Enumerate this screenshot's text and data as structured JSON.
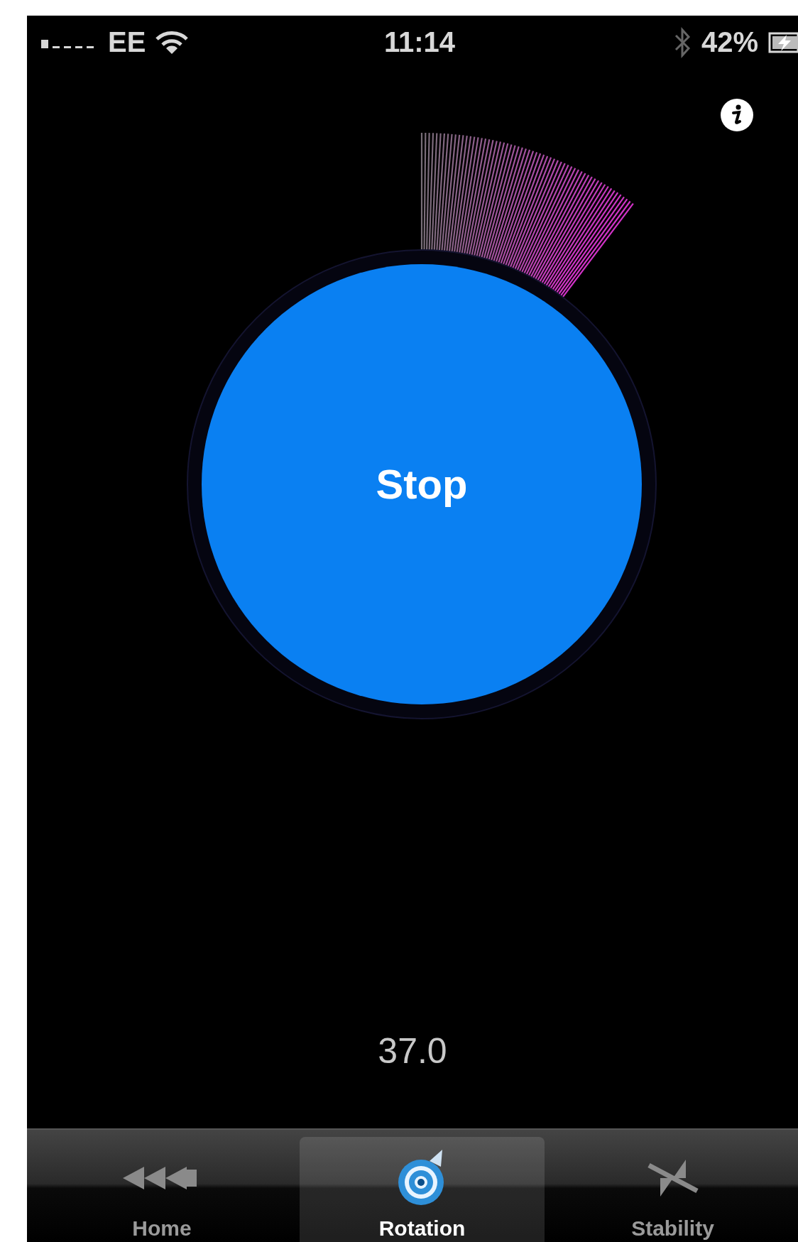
{
  "status_bar": {
    "carrier": "EE",
    "time": "11:14",
    "battery": "42%"
  },
  "rotation": {
    "button": "Stop",
    "reading": "37.0"
  },
  "tabs": [
    {
      "label": "Home",
      "kind": "home",
      "selected": false
    },
    {
      "label": "Rotation",
      "kind": "rotation",
      "selected": true
    },
    {
      "label": "Stability",
      "kind": "stability",
      "selected": false
    }
  ]
}
